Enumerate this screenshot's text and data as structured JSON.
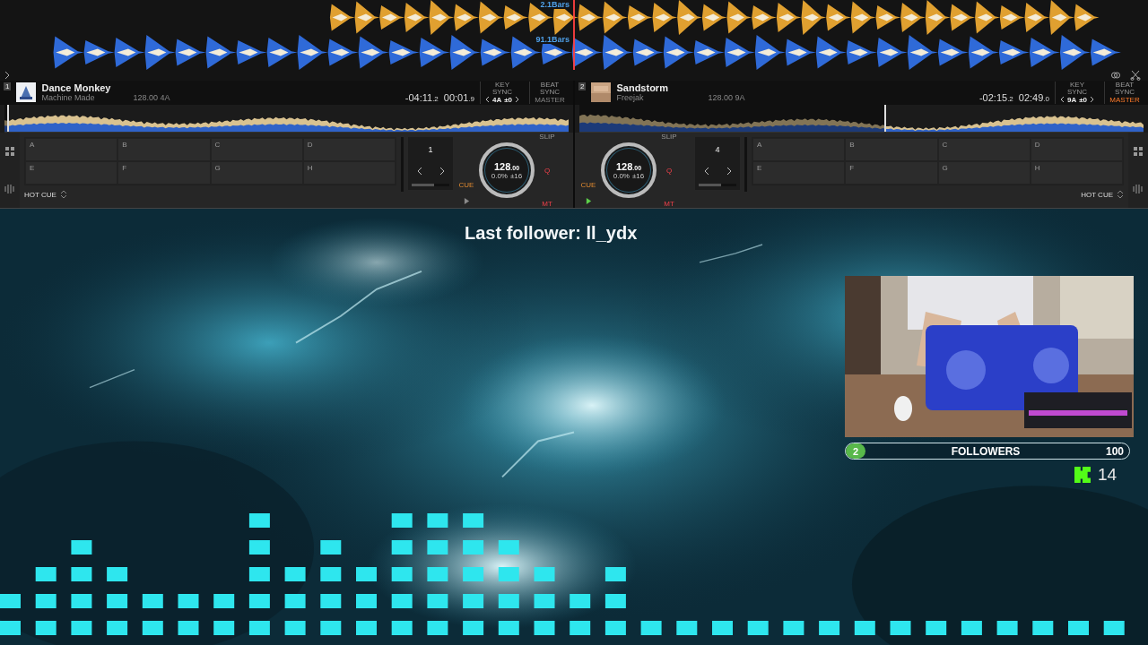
{
  "waveforms": [
    {
      "label": "2.1Bars"
    },
    {
      "label": "91.1Bars"
    }
  ],
  "decks": [
    {
      "number": "1",
      "title": "Dance Monkey",
      "artist": "Machine Made",
      "bpm_key": "128.00 4A",
      "remaining": "-04:11",
      "remaining_fraction": ".2",
      "elapsed": "00:01",
      "elapsed_fraction": ".9",
      "key_sync_label": "KEY SYNC",
      "key": "4A",
      "key_shift": "±0",
      "beat_sync_label": "BEAT SYNC",
      "master_label": "MASTER",
      "master": false,
      "level": 0.005,
      "hot_cues": [
        "A",
        "B",
        "C",
        "D",
        "E",
        "F",
        "G",
        "H"
      ],
      "pad_mode": "HOT CUE",
      "loop": "1",
      "cue": "CUE",
      "playing": false,
      "bpm": "128",
      "bpm_fraction": ".00",
      "pitch": "0.0%",
      "range": "±16",
      "slip": "SLIP",
      "quantize": "Q",
      "mt": "MT"
    },
    {
      "number": "2",
      "title": "Sandstorm",
      "artist": "Freejak",
      "bpm_key": "128.00 9A",
      "remaining": "-02:15",
      "remaining_fraction": ".2",
      "elapsed": "02:49",
      "elapsed_fraction": ".0",
      "key_sync_label": "KEY SYNC",
      "key": "9A",
      "key_shift": "±0",
      "beat_sync_label": "BEAT SYNC",
      "master_label": "MASTER",
      "master": true,
      "level": 0.54,
      "hot_cues": [
        "A",
        "B",
        "C",
        "D",
        "E",
        "F",
        "G",
        "H"
      ],
      "pad_mode": "HOT CUE",
      "loop": "4",
      "cue": "CUE",
      "playing": true,
      "bpm": "128",
      "bpm_fraction": ".00",
      "pitch": "0.0%",
      "range": "±16",
      "slip": "SLIP",
      "quantize": "Q",
      "mt": "MT"
    }
  ],
  "overlay": {
    "last_follower": "Last follower: ll_ydx",
    "followers": {
      "count": "2",
      "label": "FOLLOWERS",
      "goal": "100",
      "level": 0.02
    },
    "kick_count": "14"
  }
}
